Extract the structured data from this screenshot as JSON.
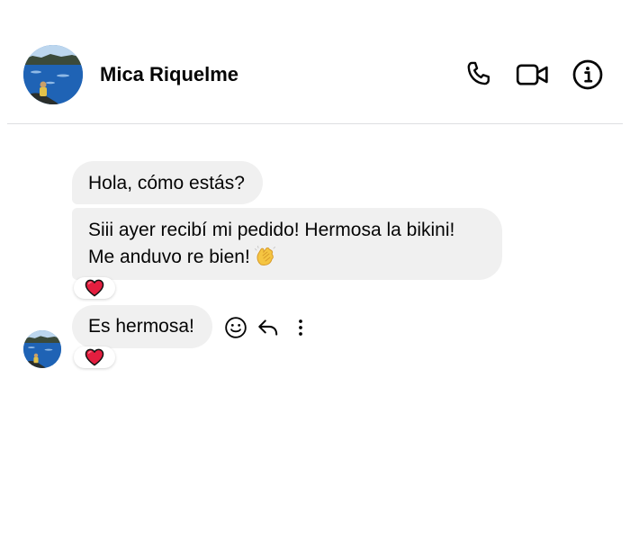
{
  "header": {
    "contact_name": "Mica Riquelme",
    "avatar_icon": "profile-photo-icon",
    "actions": [
      "phone-icon",
      "video-call-icon",
      "info-icon"
    ]
  },
  "messages": [
    {
      "text_lines": [
        "Hola, cómo estás?"
      ]
    },
    {
      "text_lines": [
        "Siii ayer recibí mi pedido! Hermosa la bikini!",
        "Me anduvo re bien!"
      ],
      "emoji": "clapping-hands-icon",
      "reaction": "heart-icon"
    },
    {
      "text_lines": [
        "Es hermosa!"
      ],
      "reaction": "heart-icon",
      "hover_actions": [
        "smiley-react-icon",
        "reply-icon",
        "more-options-icon"
      ]
    }
  ],
  "colors": {
    "bubble_bg": "#f0f0f0",
    "text": "#050505",
    "divider": "#dddfe2",
    "heart": "#e41e3f"
  }
}
